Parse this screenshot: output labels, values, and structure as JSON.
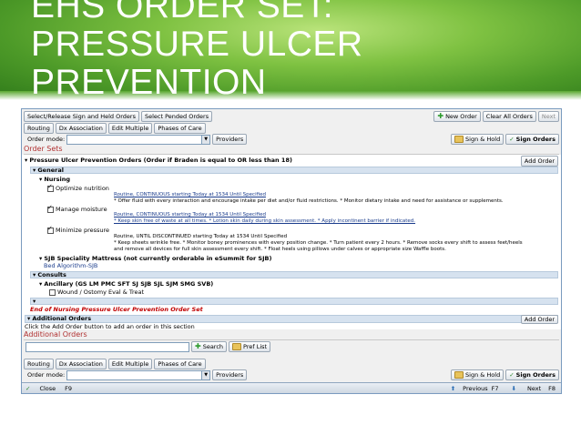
{
  "slide": {
    "title_lines": [
      "EHS ORDER SET:",
      "PRESSURE ULCER",
      "PREVENTION"
    ]
  },
  "toolbar_top": {
    "select_release": "Select/Release Sign and Held Orders",
    "select_pended": "Select Pended Orders",
    "new_order": "New Order",
    "clear_all": "Clear All Orders",
    "next": "Next"
  },
  "toolbar_actions": {
    "routing": "Routing",
    "dx_association": "Dx Association",
    "edit_multiple": "Edit Multiple",
    "phases_of_care": "Phases of Care"
  },
  "order_mode": {
    "label": "Order mode:",
    "value": "",
    "providers": "Providers",
    "sign_hold": "Sign & Hold",
    "sign_orders": "Sign Orders"
  },
  "order_sets": {
    "heading": "Order Sets",
    "set_title": "Pressure Ulcer Prevention Orders (Order if Braden is equal to OR less than 18)",
    "add_order": "Add Order",
    "general": "General",
    "nursing": "Nursing",
    "items": [
      {
        "label": "Optimize nutrition",
        "line1": "Routine, CONTINUOUS starting Today at 1534 Until Specified",
        "line2": "* Offer fluid with every interaction and encourage intake per diet and/or fluid restrictions.  * Monitor dietary intake and need for assistance or supplements."
      },
      {
        "label": "Manage moisture",
        "line1": "Routine, CONTINUOUS starting Today at 1534 Until Specified",
        "line2": "* Keep skin free of waste at all times.  * Lotion skin daily during skin assessment.   * Apply incontinent barrier if indicated."
      },
      {
        "label": "Minimize pressure",
        "line1": "Routine, UNTIL DISCONTINUED starting Today at 1534 Until Specified",
        "line2": "* Keep sheets wrinkle free.  * Monitor boney prominences with every position change.  * Turn patient every 2 hours.  * Remove socks every shift to assess feet/heels",
        "line3": "and remove all devices for full skin assessment every shift.   * Float heels using pillows under calves or appropriate size Waffle boots."
      }
    ],
    "sjb_mattress": "SJB Speciality Mattress (not currently orderable in eSummit for SJB)",
    "bed_algorithm": "Bed Algorithm-SJB",
    "consults": "Consults",
    "ancillary": "Ancillary (GS LM PMC SFT SJ SJB SJL SJM SMG SVB)",
    "wound_consult": "Wound / Ostomy Eval & Treat",
    "end_text": "End of Nursing Pressure Ulcer Prevention Order Set",
    "additional_orders_group": "Additional Orders",
    "add_order2": "Add Order",
    "click_hint": "Click the Add Order button to add an order in this section"
  },
  "additional_orders": {
    "heading": "Additional Orders",
    "search": "Search",
    "pref_list": "Pref List"
  },
  "status_bar": {
    "close": "Close",
    "close_key": "F9",
    "previous": "Previous",
    "previous_key": "F7",
    "next": "Next",
    "next_key": "F8"
  }
}
